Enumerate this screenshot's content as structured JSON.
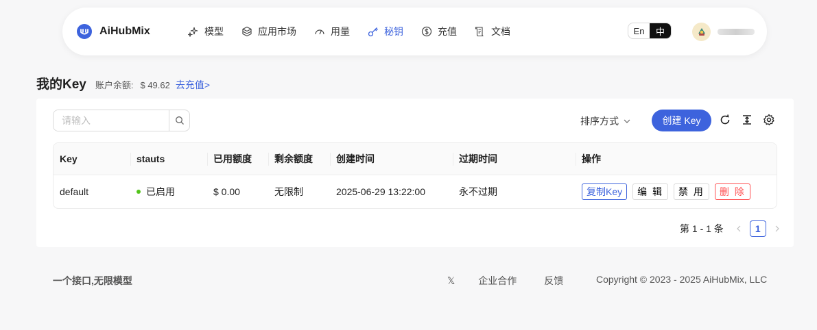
{
  "brand": {
    "name": "AiHubMix",
    "color": "#3d63dd"
  },
  "nav": [
    {
      "label": "模型",
      "icon": "sparkle-icon"
    },
    {
      "label": "应用市场",
      "icon": "cube-icon"
    },
    {
      "label": "用量",
      "icon": "gauge-icon"
    },
    {
      "label": "秘钥",
      "icon": "key-icon",
      "active": true
    },
    {
      "label": "充值",
      "icon": "dollar-icon"
    },
    {
      "label": "文档",
      "icon": "scroll-icon"
    }
  ],
  "lang": {
    "en": "En",
    "zh": "中",
    "selected": "中"
  },
  "page": {
    "title": "我的Key",
    "balance_label": "账户余额:",
    "balance_value": "$ 49.62",
    "topup_link": "去充值>"
  },
  "toolbar": {
    "search_placeholder": "请输入",
    "sort_label": "排序方式",
    "create_label": "创建 Key"
  },
  "table": {
    "columns": [
      "Key",
      "stauts",
      "已用额度",
      "剩余额度",
      "创建时间",
      "过期时间",
      "操作"
    ],
    "rows": [
      {
        "key": "default",
        "status": "已启用",
        "used": "$ 0.00",
        "remaining": "无限制",
        "created": "2025-06-29 13:22:00",
        "expires": "永不过期",
        "actions": [
          "复制Key",
          "编 辑",
          "禁 用",
          "删 除"
        ]
      }
    ]
  },
  "pagination": {
    "summary": "第 1 - 1 条",
    "current_page": "1"
  },
  "footer": {
    "slogan": "一个接口,无限模型",
    "x_link": "𝕏",
    "links": [
      "企业合作",
      "反馈"
    ],
    "copyright": "Copyright © 2023 - 2025 AiHubMix, LLC"
  }
}
